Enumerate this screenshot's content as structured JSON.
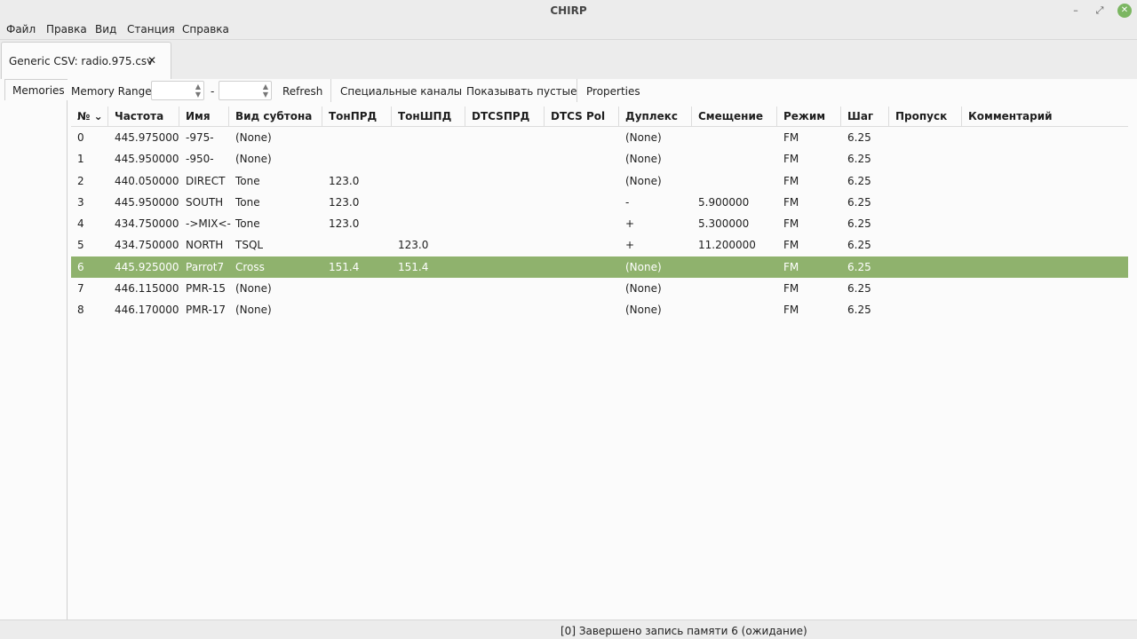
{
  "window": {
    "title": "CHIRP"
  },
  "menu": [
    "Файл",
    "Правка",
    "Вид",
    "Станция",
    "Справка"
  ],
  "file_tab": {
    "label": "Generic CSV: radio.975.csv",
    "close": "✕"
  },
  "side_tab": {
    "label": "Memories"
  },
  "toolbar": {
    "memory_range_label": "Memory Range:",
    "range_start": "",
    "range_end": "",
    "dash": "-",
    "refresh": "Refresh",
    "special_channels": "Специальные каналы",
    "show_empty": "Показывать пустые",
    "properties": "Properties"
  },
  "columns": [
    "№",
    "Частота",
    "Имя",
    "Вид субтона",
    "ТонПРД",
    "ТонШПД",
    "DTCSПРД",
    "DTCS Pol",
    "Дуплекс",
    "Смещение",
    "Режим",
    "Шаг",
    "Пропуск",
    "Комментарий"
  ],
  "sort_indicator": "⌄",
  "rows": [
    [
      "0",
      "445.975000",
      "-975-",
      "(None)",
      "",
      "",
      "",
      "",
      "(None)",
      "",
      "FM",
      "6.25",
      "",
      ""
    ],
    [
      "1",
      "445.950000",
      "-950-",
      "(None)",
      "",
      "",
      "",
      "",
      "(None)",
      "",
      "FM",
      "6.25",
      "",
      ""
    ],
    [
      "2",
      "440.050000",
      "DIRECT",
      "Tone",
      "123.0",
      "",
      "",
      "",
      "(None)",
      "",
      "FM",
      "6.25",
      "",
      ""
    ],
    [
      "3",
      "445.950000",
      "SOUTH",
      "Tone",
      "123.0",
      "",
      "",
      "",
      "-",
      "5.900000",
      "FM",
      "6.25",
      "",
      ""
    ],
    [
      "4",
      "434.750000",
      "->MIX<-",
      "Tone",
      "123.0",
      "",
      "",
      "",
      "+",
      "5.300000",
      "FM",
      "6.25",
      "",
      ""
    ],
    [
      "5",
      "434.750000",
      "NORTH",
      "TSQL",
      "",
      "123.0",
      "",
      "",
      "+",
      "11.200000",
      "FM",
      "6.25",
      "",
      ""
    ],
    [
      "6",
      "445.925000",
      "Parrot7",
      "Cross",
      "151.4",
      "151.4",
      "",
      "",
      "(None)",
      "",
      "FM",
      "6.25",
      "",
      ""
    ],
    [
      "7",
      "446.115000",
      "PMR-15",
      "(None)",
      "",
      "",
      "",
      "",
      "(None)",
      "",
      "FM",
      "6.25",
      "",
      ""
    ],
    [
      "8",
      "446.170000",
      "PMR-17",
      "(None)",
      "",
      "",
      "",
      "",
      "(None)",
      "",
      "FM",
      "6.25",
      "",
      ""
    ]
  ],
  "selected_row": 6,
  "status": "[0] Завершено запись памяти 6 (ожидание)",
  "colors": {
    "selection": "#8fb26d",
    "close_button": "#7bb661"
  }
}
